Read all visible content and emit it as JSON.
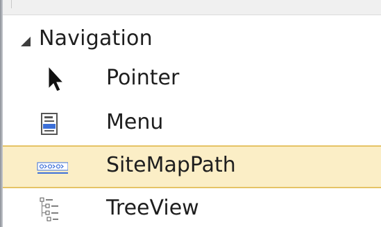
{
  "toolbox": {
    "group": {
      "label": "Navigation",
      "expanded": true,
      "icon": "triangle-expanded-icon"
    },
    "items": [
      {
        "label": "Pointer",
        "icon": "pointer-arrow-icon",
        "selected": false
      },
      {
        "label": "Menu",
        "icon": "menu-icon",
        "selected": false
      },
      {
        "label": "SiteMapPath",
        "icon": "sitemappath-icon",
        "selected": true
      },
      {
        "label": "TreeView",
        "icon": "treeview-icon",
        "selected": false
      }
    ],
    "colors": {
      "selection_background": "#fbeec6",
      "selection_border": "#e5c365",
      "text": "#1e1e1e",
      "icon_accent": "#3b6fd8"
    }
  }
}
